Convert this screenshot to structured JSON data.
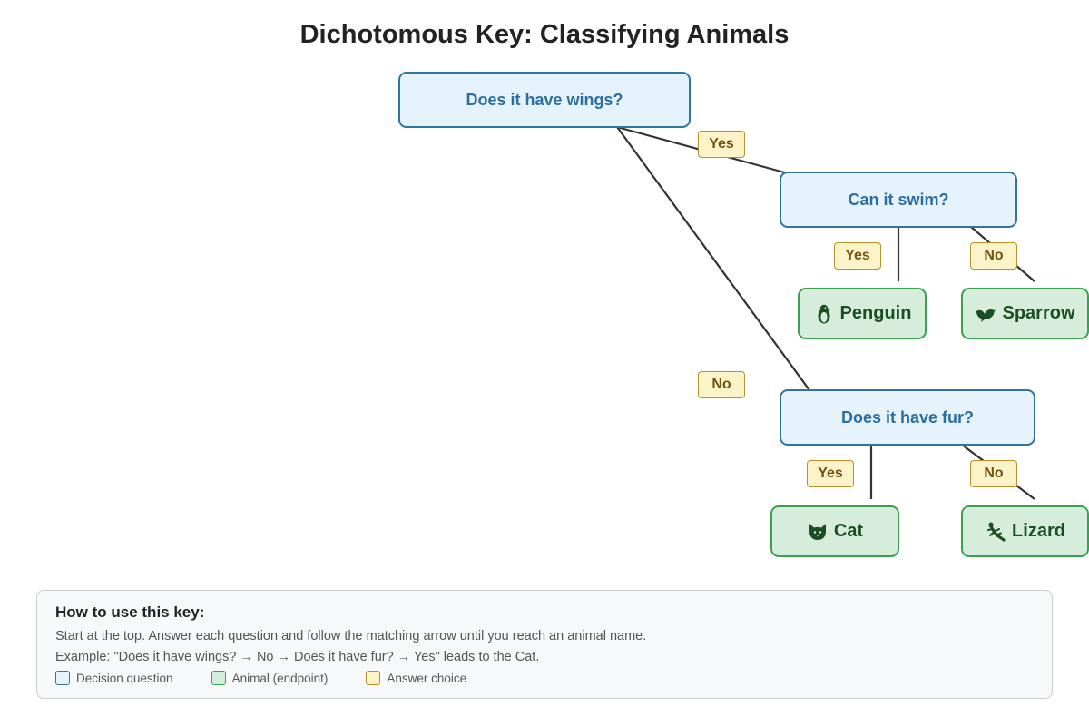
{
  "title": "Dichotomous Key: Classifying Animals",
  "questions": {
    "wings": "Does it have wings?",
    "swim": "Can it swim?",
    "fur": "Does it have fur?"
  },
  "animals": {
    "penguin": {
      "label": "Penguin",
      "icon": "penguin-icon"
    },
    "sparrow": {
      "label": "Sparrow",
      "icon": "bird-icon"
    },
    "cat": {
      "label": "Cat",
      "icon": "cat-icon"
    },
    "lizard": {
      "label": "Lizard",
      "icon": "lizard-icon"
    }
  },
  "answers": {
    "wings_yes": "Yes",
    "wings_no": "No",
    "swim_yes": "Yes",
    "swim_no": "No",
    "fur_yes": "Yes",
    "fur_no": "No"
  },
  "howto": {
    "title": "How to use this key:",
    "line1": "Start at the top. Answer each question and follow the matching arrow until you reach an animal name.",
    "line2": "Example: \"Does it have wings? → No → Does it have fur? → Yes\" leads to the Cat."
  },
  "legend": {
    "question": "Decision question",
    "animal": "Animal (endpoint)",
    "answer": "Answer choice"
  },
  "colors": {
    "question_fill": "#e7f3fc",
    "question_border": "#3074a0",
    "animal_fill": "#d6eddb",
    "animal_border": "#3aa24f",
    "answer_fill": "#fdf3c9",
    "answer_border": "#b8902b"
  }
}
